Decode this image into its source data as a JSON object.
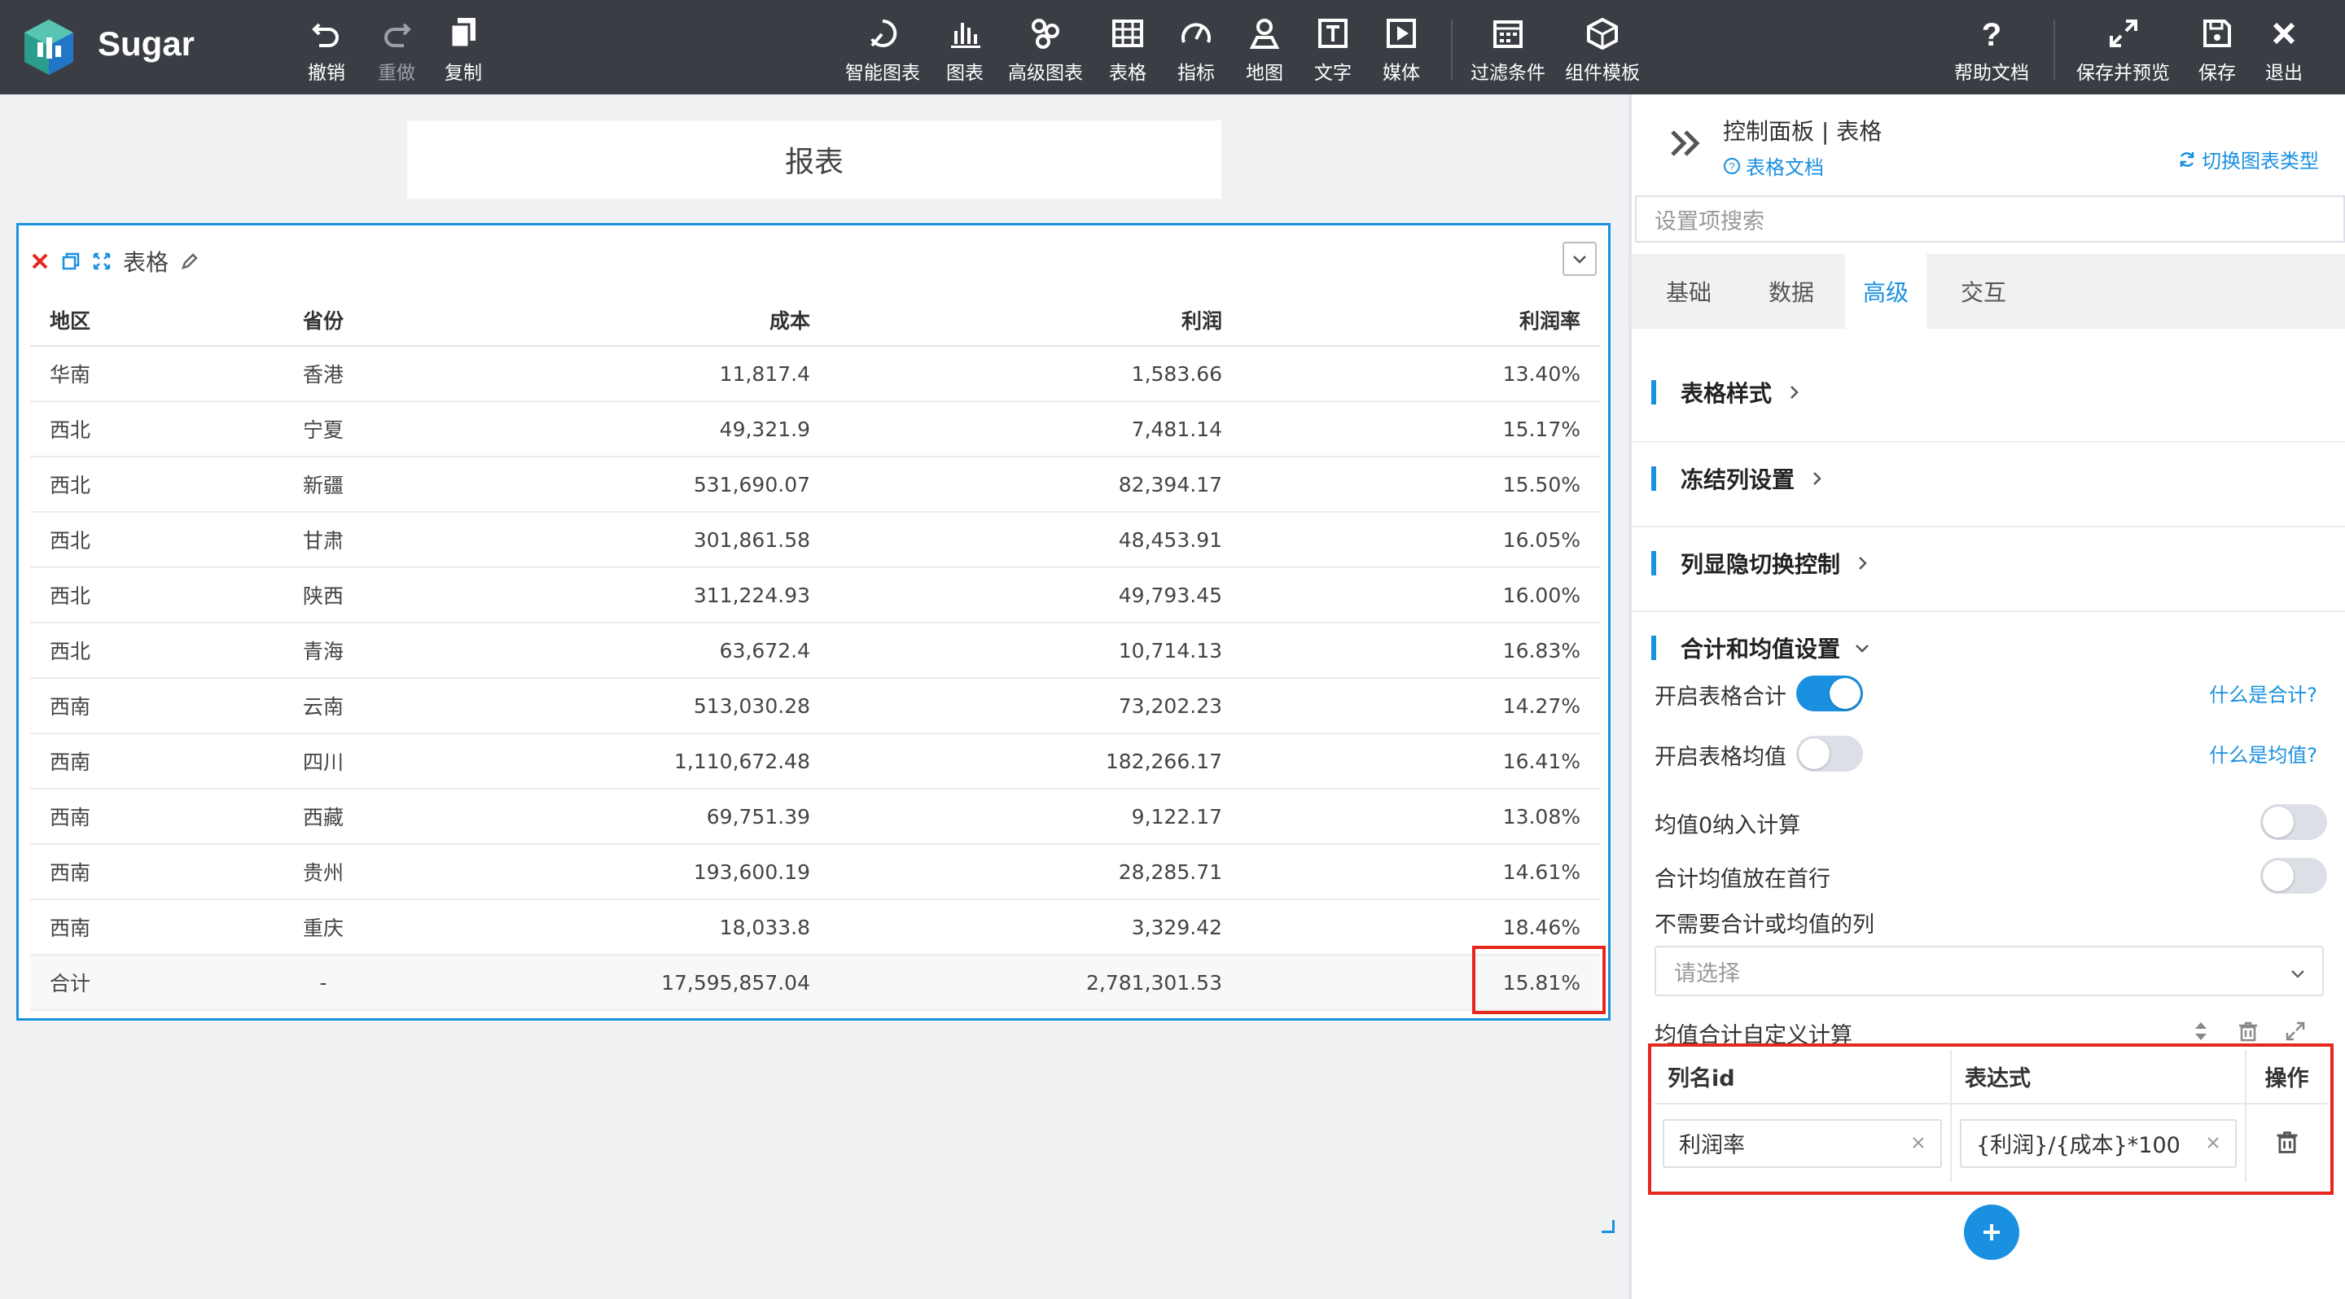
{
  "app": {
    "brand": "Sugar"
  },
  "toolbar_left": [
    {
      "id": "undo",
      "label": "撤销",
      "icon": "undo-icon"
    },
    {
      "id": "redo",
      "label": "重做",
      "icon": "redo-icon",
      "disabled": true
    },
    {
      "id": "copy",
      "label": "复制",
      "icon": "copy-icon"
    }
  ],
  "toolbar_center": [
    {
      "id": "smart-chart",
      "label": "智能图表",
      "icon": "smart-chart-icon"
    },
    {
      "id": "chart",
      "label": "图表",
      "icon": "bar-chart-icon"
    },
    {
      "id": "advanced-chart",
      "label": "高级图表",
      "icon": "advanced-chart-icon"
    },
    {
      "id": "table",
      "label": "表格",
      "icon": "table-icon"
    },
    {
      "id": "metric",
      "label": "指标",
      "icon": "gauge-icon"
    },
    {
      "id": "map",
      "label": "地图",
      "icon": "map-pin-icon"
    },
    {
      "id": "text",
      "label": "文字",
      "icon": "text-icon"
    },
    {
      "id": "media",
      "label": "媒体",
      "icon": "media-icon"
    },
    {
      "id": "filter",
      "label": "过滤条件",
      "icon": "filter-calendar-icon"
    },
    {
      "id": "component-template",
      "label": "组件模板",
      "icon": "cube-icon"
    }
  ],
  "toolbar_right": [
    {
      "id": "help",
      "label": "帮助文档",
      "icon": "help-icon"
    },
    {
      "id": "save-preview",
      "label": "保存并预览",
      "icon": "expand-icon"
    },
    {
      "id": "save",
      "label": "保存",
      "icon": "save-icon"
    },
    {
      "id": "exit",
      "label": "退出",
      "icon": "close-icon"
    }
  ],
  "report": {
    "title": "报表"
  },
  "widget": {
    "title": "表格",
    "columns": [
      "地区",
      "省份",
      "成本",
      "利润",
      "利润率"
    ],
    "rows": [
      [
        "华南",
        "香港",
        "11,817.4",
        "1,583.66",
        "13.40%"
      ],
      [
        "西北",
        "宁夏",
        "49,321.9",
        "7,481.14",
        "15.17%"
      ],
      [
        "西北",
        "新疆",
        "531,690.07",
        "82,394.17",
        "15.50%"
      ],
      [
        "西北",
        "甘肃",
        "301,861.58",
        "48,453.91",
        "16.05%"
      ],
      [
        "西北",
        "陕西",
        "311,224.93",
        "49,793.45",
        "16.00%"
      ],
      [
        "西北",
        "青海",
        "63,672.4",
        "10,714.13",
        "16.83%"
      ],
      [
        "西南",
        "云南",
        "513,030.28",
        "73,202.23",
        "14.27%"
      ],
      [
        "西南",
        "四川",
        "1,110,672.48",
        "182,266.17",
        "16.41%"
      ],
      [
        "西南",
        "西藏",
        "69,751.39",
        "9,122.17",
        "13.08%"
      ],
      [
        "西南",
        "贵州",
        "193,600.19",
        "28,285.71",
        "14.61%"
      ],
      [
        "西南",
        "重庆",
        "18,033.8",
        "3,329.42",
        "18.46%"
      ]
    ],
    "total": [
      "合计",
      "-",
      "17,595,857.04",
      "2,781,301.53",
      "15.81%"
    ]
  },
  "panel": {
    "title": "控制面板 | 表格",
    "doc_link": "表格文档",
    "switch_type": "切换图表类型",
    "search_placeholder": "设置项搜索",
    "tabs": [
      {
        "label": "基础",
        "active": false
      },
      {
        "label": "数据",
        "active": false
      },
      {
        "label": "高级",
        "active": true
      },
      {
        "label": "交互",
        "active": false
      }
    ],
    "sections": {
      "table_style": "表格样式",
      "freeze_columns": "冻结列设置",
      "column_toggle": "列显隐切换控制",
      "sum_avg": "合计和均值设置"
    },
    "settings": {
      "enable_sum": {
        "label": "开启表格合计",
        "on": true,
        "help": "什么是合计?"
      },
      "enable_avg": {
        "label": "开启表格均值",
        "on": false,
        "help": "什么是均值?"
      },
      "avg_zero": {
        "label": "均值0纳入计算",
        "on": false
      },
      "sum_first": {
        "label": "合计均值放在首行",
        "on": false
      },
      "exclude_cols_label": "不需要合计或均值的列",
      "exclude_cols_placeholder": "请选择",
      "custom_calc_label": "均值合计自定义计算"
    },
    "custom_calc": {
      "headers": [
        "列名id",
        "表达式",
        "操作"
      ],
      "rows": [
        {
          "column": "利润率",
          "expression": "{利润}/{成本}*100"
        }
      ]
    }
  }
}
